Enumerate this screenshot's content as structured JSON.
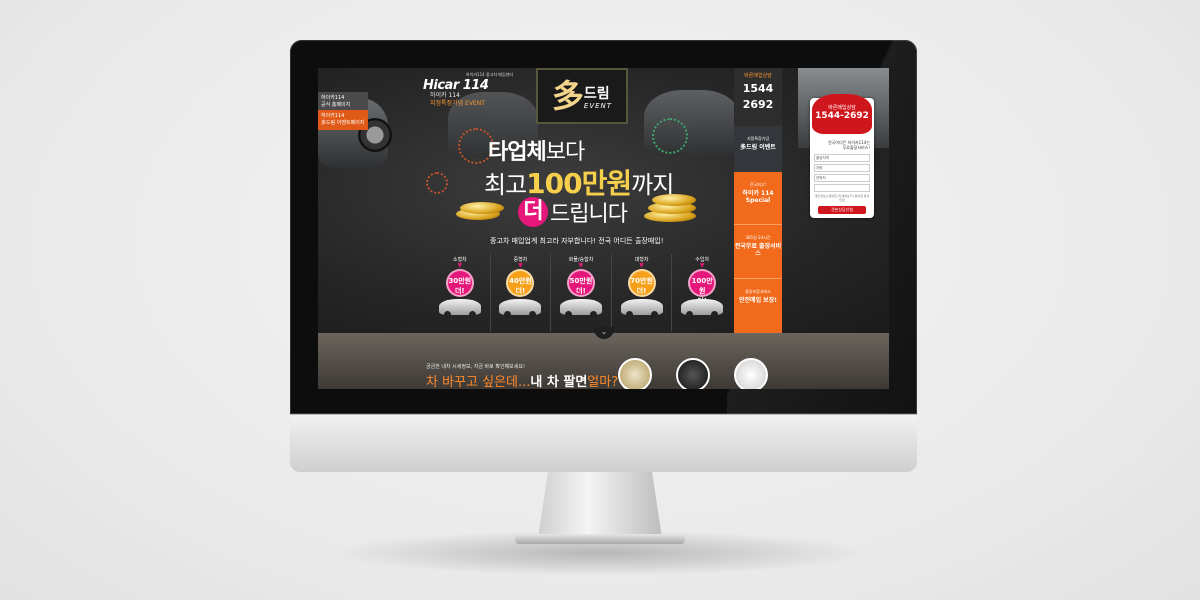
{
  "screen": {
    "logo": {
      "small": "하이카114 중고차 매입센터",
      "name": "Hicar 114"
    },
    "logo_sub": {
      "line1": "하이카 114",
      "line2": "지정특정기념 EVENT"
    },
    "left_tabs": [
      {
        "line1": "하이카114",
        "line2": "공식 홈페이지"
      },
      {
        "line1": "하이카114",
        "line2": "多드림 이벤트페이지"
      }
    ],
    "emblem": {
      "big": "多",
      "text": "드림",
      "sub": "EVENT"
    },
    "headline": {
      "line1_bold": "타업체",
      "line1_rest": "보다",
      "line2_pre": "최고",
      "line2_gold": "100만원",
      "line2_post": "까지",
      "line3_badge": "더",
      "line3_rest": "드립니다"
    },
    "tagline": "중고차 매입업계 최고라 자부합니다! 전국 어디든 출장매입!",
    "categories": [
      {
        "name": "소형차",
        "amount": "30만원",
        "more": "더!",
        "color": "pink"
      },
      {
        "name": "중형차",
        "amount": "40만원",
        "more": "더!",
        "color": "orange"
      },
      {
        "name": "화물/승합차",
        "amount": "50만원",
        "more": "더!",
        "color": "pink"
      },
      {
        "name": "대형차",
        "amount": "70만원",
        "more": "더!",
        "color": "orange"
      },
      {
        "name": "수입차",
        "amount": "100만원",
        "more": "더!",
        "color": "pink"
      }
    ],
    "right_column": {
      "consult_title": "바른매입상담",
      "phone_a": "1544",
      "phone_b": "2692",
      "box2_small": "지정특정기념",
      "box2_bold": "多드림 이벤트",
      "box3_small": "전국최고!",
      "box3_bold": "하이카 114 Special",
      "box4_small": "365일 24시간",
      "box4_bold": "전국무료 출장서비스",
      "box5_small": "중장보증서비스",
      "box5_bold": "안전매입 보장!"
    },
    "panel": {
      "title": "바른매입상담",
      "phone": "1544-2692",
      "desc1": "전국어디든 하이카114는",
      "desc2": "무료출장서비스!",
      "fields": [
        "출장지역",
        "차량",
        "연락처",
        ""
      ],
      "note": "개인정보수집방침 [자세히보기] 동의함 동의안함",
      "button": "견본상담신청"
    },
    "bottom": {
      "small": "궁금한 내차 시세정보, 지금 바로 확인해보세요!",
      "big_pre": "차 바꾸고 싶은데...",
      "big_bold": "내 차 팔면",
      "big_post": "얼마?"
    }
  }
}
